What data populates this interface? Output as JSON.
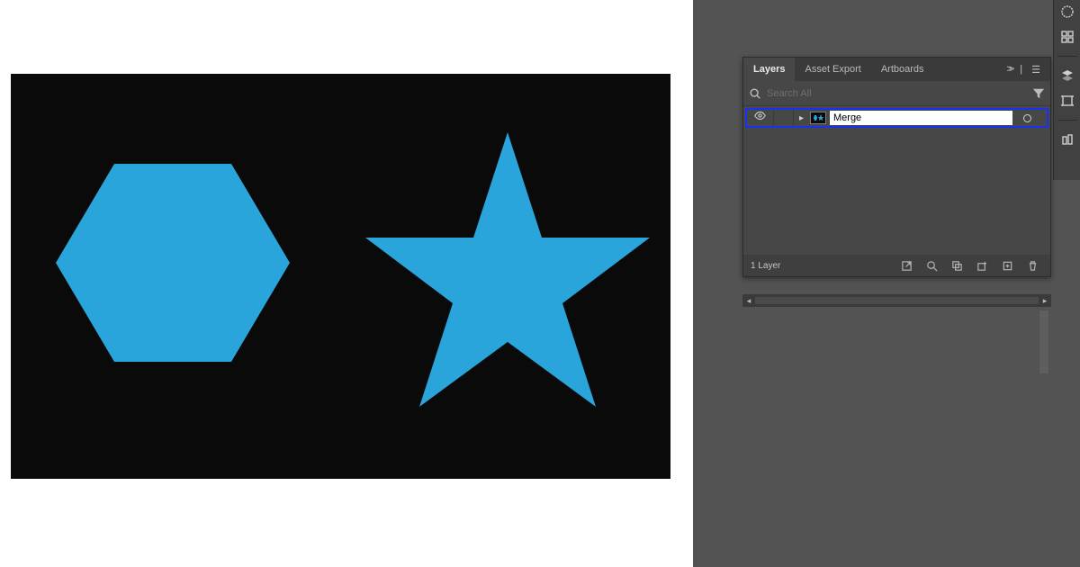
{
  "canvas": {
    "hexagon_color": "#29a5dc",
    "star_color": "#29a5dc",
    "artboard_bg": "#0a0a0a"
  },
  "panel": {
    "tabs": {
      "layers": "Layers",
      "asset_export": "Asset Export",
      "artboards": "Artboards"
    },
    "search_placeholder": "Search All",
    "layer_name": "Merge",
    "footer_count": "1 Layer"
  },
  "rail": {
    "items": [
      "color-icon",
      "swatches-icon",
      "layers-icon",
      "artboards-icon",
      "libraries-icon"
    ]
  }
}
